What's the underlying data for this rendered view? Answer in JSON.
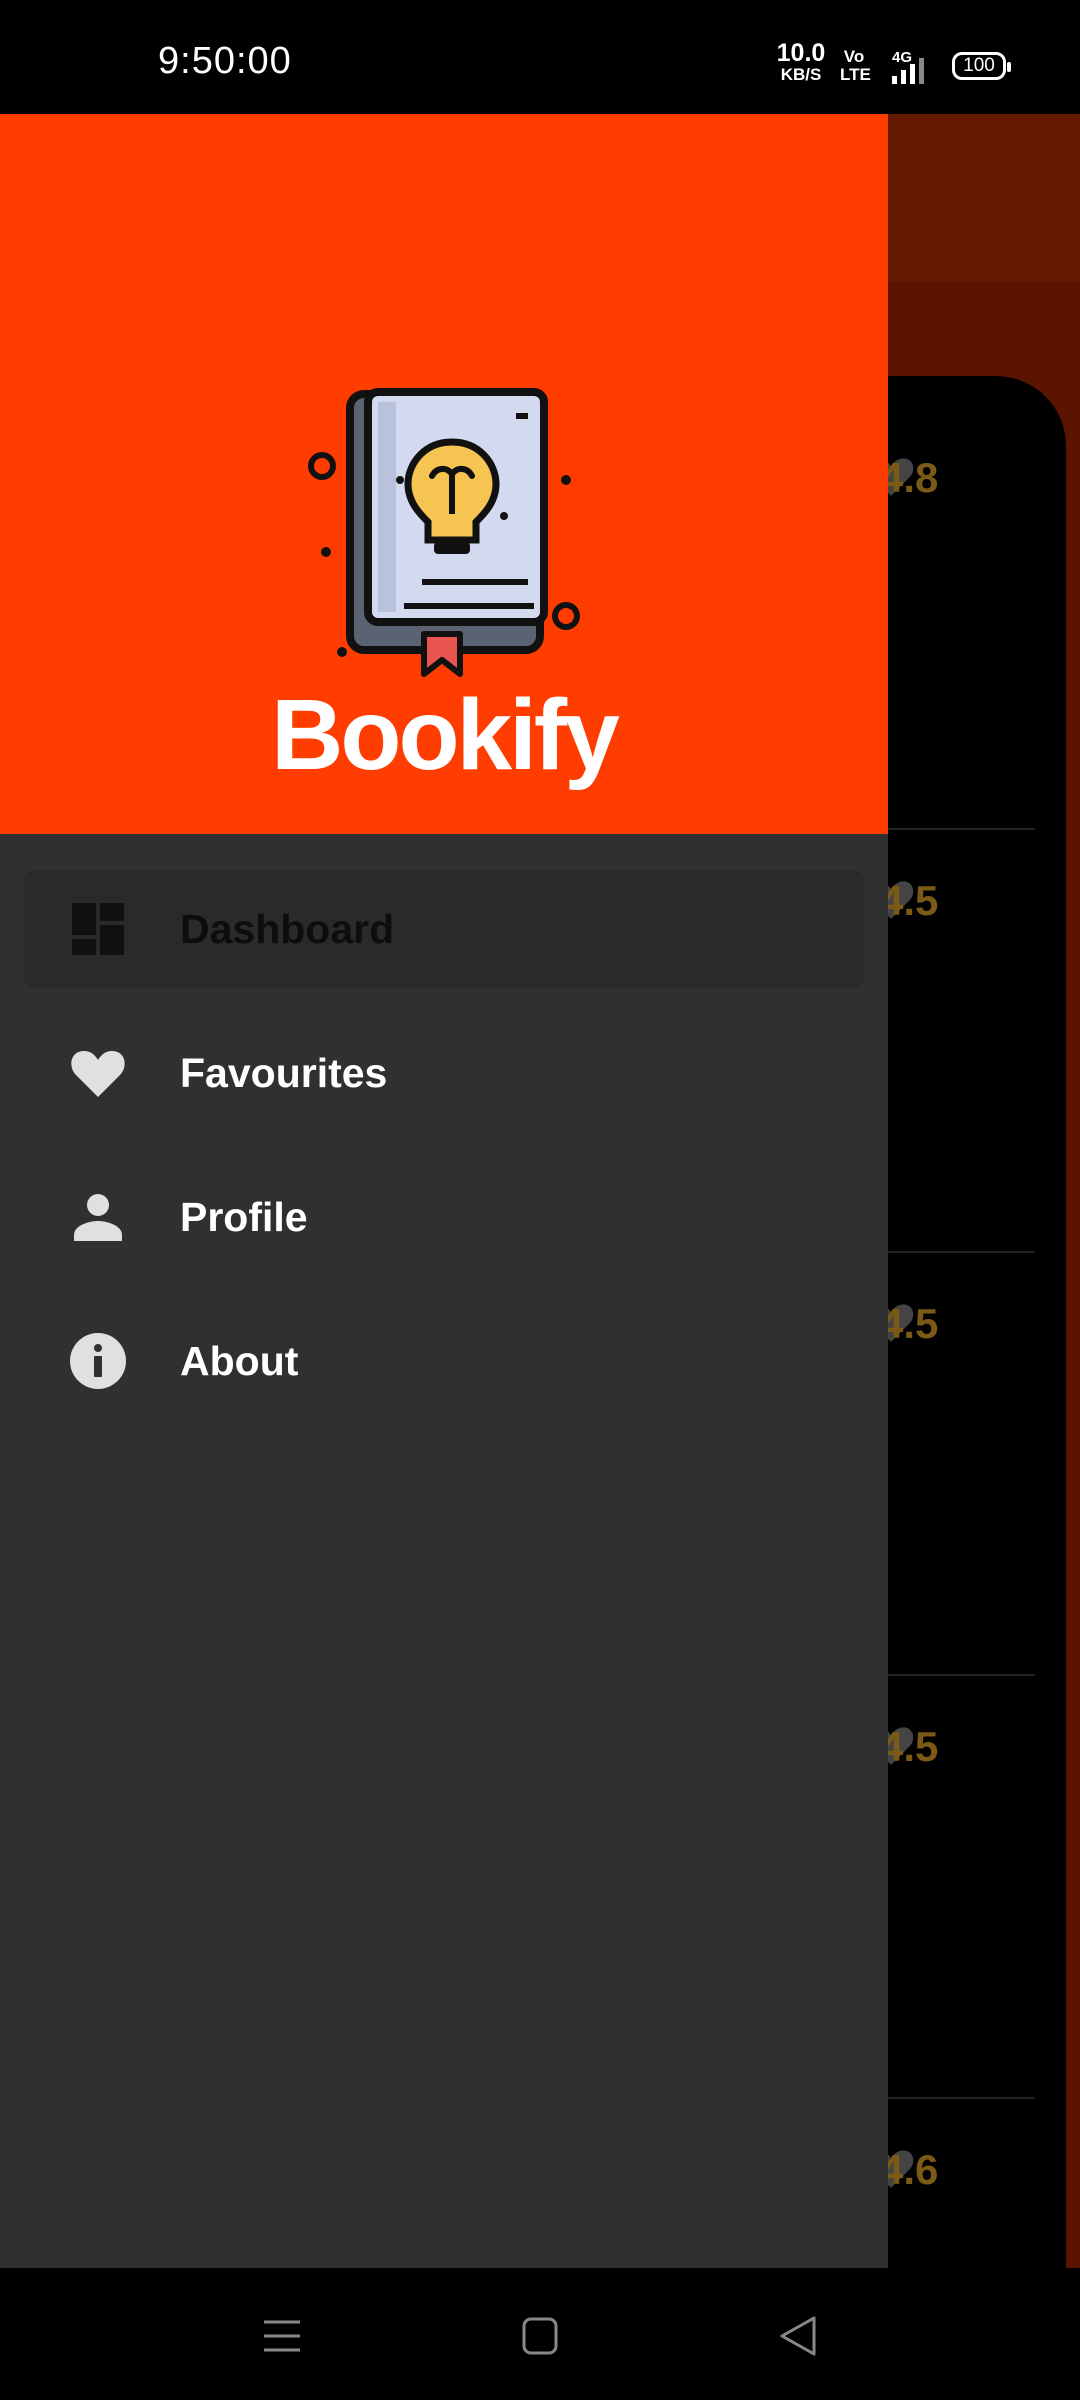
{
  "status_bar": {
    "time": "9:50:00",
    "net_speed_value": "10.0",
    "net_speed_unit": "KB/S",
    "volte_top": "Vo",
    "volte_bottom": "LTE",
    "network": "4G",
    "battery": "100"
  },
  "drawer": {
    "header": {
      "app_name": "Bookify",
      "logo_icon": "book-lightbulb-icon",
      "background_color": "#ff3d00"
    },
    "menu": [
      {
        "label": "Dashboard",
        "icon": "dashboard-icon",
        "selected": true
      },
      {
        "label": "Favourites",
        "icon": "heart-icon",
        "selected": false
      },
      {
        "label": "Profile",
        "icon": "person-icon",
        "selected": false
      },
      {
        "label": "About",
        "icon": "info-icon",
        "selected": false
      }
    ]
  },
  "background_list": {
    "ratings": [
      "4.8",
      "4.5",
      "4.5",
      "4.5",
      "4.6"
    ],
    "rating_color": "#7a5a14"
  },
  "nav_bar": {
    "buttons": [
      "menu-icon",
      "home-icon",
      "back-icon"
    ]
  }
}
